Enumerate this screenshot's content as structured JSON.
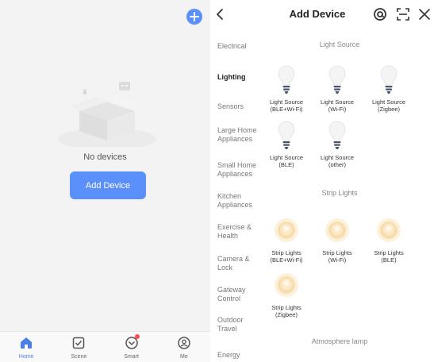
{
  "home": {
    "empty_text": "No devices",
    "add_button": "Add Device",
    "tabs": [
      {
        "label": "Home",
        "icon": "home-icon"
      },
      {
        "label": "Scene",
        "icon": "scene-icon"
      },
      {
        "label": "Smart",
        "icon": "smart-icon"
      },
      {
        "label": "Me",
        "icon": "me-icon"
      }
    ]
  },
  "add_device": {
    "title": "Add Device",
    "categories": [
      {
        "label": "Electrical"
      },
      {
        "label": "Lighting"
      },
      {
        "label": "Sensors"
      },
      {
        "label": "Large Home Appliances"
      },
      {
        "label": "Small Home Appliances"
      },
      {
        "label": "Kitchen Appliances"
      },
      {
        "label": "Exercise & Health"
      },
      {
        "label": "Camera & Lock"
      },
      {
        "label": "Gateway Control"
      },
      {
        "label": "Outdoor Travel"
      },
      {
        "label": "Energy"
      }
    ],
    "active_category": "Lighting",
    "sections": [
      {
        "title": "Light Source",
        "devices": [
          {
            "name": "Light Source",
            "sub": "(BLE+Wi-Fi)"
          },
          {
            "name": "Light Source",
            "sub": "(Wi-Fi)"
          },
          {
            "name": "Light Source",
            "sub": "(Zigbee)"
          },
          {
            "name": "Light Source",
            "sub": "(BLE)"
          },
          {
            "name": "Light Source",
            "sub": "(other)"
          }
        ]
      },
      {
        "title": "Strip Lights",
        "devices": [
          {
            "name": "Strip Lights",
            "sub": "(BLE+Wi-Fi)"
          },
          {
            "name": "Strip Lights",
            "sub": "(Wi-Fi)"
          },
          {
            "name": "Strip Lights",
            "sub": "(BLE)"
          },
          {
            "name": "Strip Lights",
            "sub": "(Zigbee)"
          }
        ]
      },
      {
        "title": "Atmosphere lamp",
        "devices": []
      }
    ]
  },
  "colors": {
    "accent": "#5b8ff9",
    "active_tab": "#4a7fe8",
    "badge": "#ff4d4f"
  }
}
